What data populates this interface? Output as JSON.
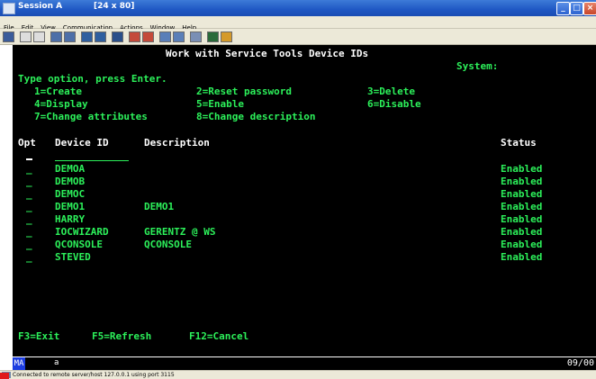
{
  "window": {
    "title": "Session A",
    "size": "[24 x 80]"
  },
  "menu": [
    "File",
    "Edit",
    "View",
    "Communication",
    "Actions",
    "Window",
    "Help"
  ],
  "screen": {
    "title": "Work with Service Tools Device IDs",
    "system_label": "System:",
    "instruction": "Type option, press Enter.",
    "options": [
      "1=Create",
      "2=Reset password",
      "3=Delete",
      "4=Display",
      "5=Enable",
      "6=Disable",
      "7=Change attributes",
      "8=Change description"
    ],
    "columns": {
      "opt": "Opt",
      "device_id": "Device ID",
      "description": "Description",
      "status": "Status"
    },
    "rows": [
      {
        "opt": "_",
        "device_id": "DEMOA",
        "description": "",
        "status": "Enabled"
      },
      {
        "opt": "_",
        "device_id": "DEMOB",
        "description": "",
        "status": "Enabled"
      },
      {
        "opt": "_",
        "device_id": "DEMOC",
        "description": "",
        "status": "Enabled"
      },
      {
        "opt": "_",
        "device_id": "DEMO1",
        "description": "DEMO1",
        "status": "Enabled"
      },
      {
        "opt": "_",
        "device_id": "HARRY",
        "description": "",
        "status": "Enabled"
      },
      {
        "opt": "_",
        "device_id": "IOCWIZARD",
        "description": "GERENTZ @ WS",
        "status": "Enabled"
      },
      {
        "opt": "_",
        "device_id": "QCONSOLE",
        "description": "QCONSOLE",
        "status": "Enabled"
      },
      {
        "opt": "_",
        "device_id": "STEVED",
        "description": "",
        "status": "Enabled"
      }
    ],
    "function_keys": [
      "F3=Exit",
      "F5=Refresh",
      "F12=Cancel"
    ]
  },
  "oia": {
    "mode": "MA",
    "indicator": "a",
    "cursor_position": "09/00"
  },
  "statusbar": {
    "text": "Connected to remote server/host 127.0.0.1 using port 3115"
  },
  "colors": {
    "screen_bg": "#000000",
    "field_text": "#2cf05a",
    "title_text": "#ffffff",
    "oia_mode_bg": "#1c3de0"
  },
  "icons": [
    "session-icon",
    "minimize-icon",
    "maximize-icon",
    "close-icon"
  ]
}
